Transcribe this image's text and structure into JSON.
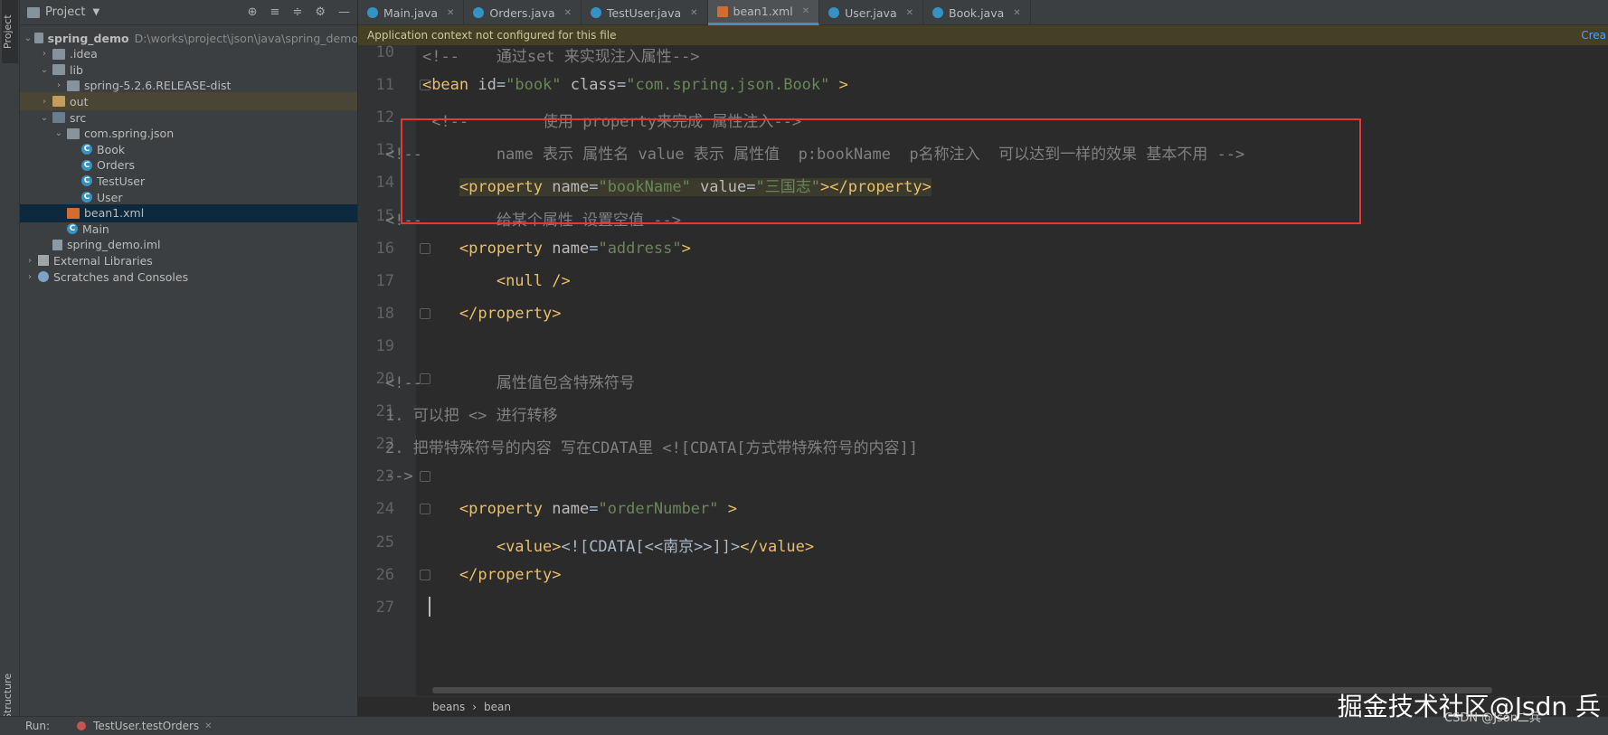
{
  "sidebar": {
    "project_tab": "Project",
    "structure_tab": "Structure"
  },
  "project_panel": {
    "title": "Project",
    "tree": [
      {
        "name": "spring_demo",
        "path": "D:\\works\\project\\json\\java\\spring_demo",
        "level": 0,
        "arrow": "expanded",
        "icon": "module-folder"
      },
      {
        "name": ".idea",
        "level": 1,
        "arrow": "collapsed",
        "icon": "folder"
      },
      {
        "name": "lib",
        "level": 1,
        "arrow": "expanded",
        "icon": "folder"
      },
      {
        "name": "spring-5.2.6.RELEASE-dist",
        "level": 2,
        "arrow": "collapsed",
        "icon": "folder"
      },
      {
        "name": "out",
        "level": 1,
        "arrow": "collapsed",
        "icon": "out-folder"
      },
      {
        "name": "src",
        "level": 1,
        "arrow": "expanded",
        "icon": "source-folder"
      },
      {
        "name": "com.spring.json",
        "level": 2,
        "arrow": "expanded",
        "icon": "package"
      },
      {
        "name": "Book",
        "level": 3,
        "icon": "class"
      },
      {
        "name": "Orders",
        "level": 3,
        "icon": "class"
      },
      {
        "name": "TestUser",
        "level": 3,
        "icon": "class"
      },
      {
        "name": "User",
        "level": 3,
        "icon": "class"
      },
      {
        "name": "bean1.xml",
        "level": 2,
        "icon": "xml",
        "selected": true
      },
      {
        "name": "Main",
        "level": 2,
        "icon": "class"
      },
      {
        "name": "spring_demo.iml",
        "level": 1,
        "icon": "file"
      },
      {
        "name": "External Libraries",
        "level": 0,
        "arrow": "collapsed",
        "icon": "library"
      },
      {
        "name": "Scratches and Consoles",
        "level": 0,
        "arrow": "collapsed",
        "icon": "scratch"
      }
    ]
  },
  "tabs": [
    {
      "label": "Main.java",
      "icon": "class"
    },
    {
      "label": "Orders.java",
      "icon": "class"
    },
    {
      "label": "TestUser.java",
      "icon": "class"
    },
    {
      "label": "bean1.xml",
      "icon": "xml",
      "active": true
    },
    {
      "label": "User.java",
      "icon": "class"
    },
    {
      "label": "Book.java",
      "icon": "class"
    }
  ],
  "notice": {
    "text": "Application context not configured for this file",
    "link": "Crea"
  },
  "editor": {
    "lines": [
      {
        "num": "10",
        "segments": [
          {
            "t": "    ",
            "c": ""
          },
          {
            "t": "<!--    通过set 来实现注入属性-->",
            "c": "comment"
          }
        ]
      },
      {
        "num": "11",
        "segments": [
          {
            "t": "    ",
            "c": ""
          },
          {
            "t": "<bean ",
            "c": "tag"
          },
          {
            "t": "id",
            "c": "attr"
          },
          {
            "t": "=",
            "c": ""
          },
          {
            "t": "\"book\"",
            "c": "str"
          },
          {
            "t": " ",
            "c": ""
          },
          {
            "t": "class",
            "c": "attr"
          },
          {
            "t": "=",
            "c": ""
          },
          {
            "t": "\"com.spring.json.Book\"",
            "c": "str"
          },
          {
            "t": " >",
            "c": "tag"
          }
        ]
      },
      {
        "num": "12",
        "segments": [
          {
            "t": "     ",
            "c": ""
          },
          {
            "t": "<!--        使用 property来完成 属性注入-->",
            "c": "comment"
          }
        ]
      },
      {
        "num": "13",
        "segments": [
          {
            "t": "<!--        name 表示 属性名 value 表示 属性值  p:bookName  p名称注入  可以达到一样的效果 基本不用 -->",
            "c": "comment"
          }
        ]
      },
      {
        "num": "14",
        "segments": [
          {
            "t": "        ",
            "c": ""
          },
          {
            "t": "<property ",
            "c": "tag hl"
          },
          {
            "t": "name",
            "c": "attr hl"
          },
          {
            "t": "=",
            "c": "hl"
          },
          {
            "t": "\"bookName\"",
            "c": "str hl"
          },
          {
            "t": " ",
            "c": "hl"
          },
          {
            "t": "value",
            "c": "attr hl"
          },
          {
            "t": "=",
            "c": "hl"
          },
          {
            "t": "\"三国志\"",
            "c": "str hl"
          },
          {
            "t": "></property>",
            "c": "tag hl"
          }
        ]
      },
      {
        "num": "15",
        "segments": [
          {
            "t": "<!--        给某个属性 设置空值 -->",
            "c": "comment"
          }
        ]
      },
      {
        "num": "16",
        "segments": [
          {
            "t": "        ",
            "c": ""
          },
          {
            "t": "<property ",
            "c": "tag"
          },
          {
            "t": "name",
            "c": "attr"
          },
          {
            "t": "=",
            "c": ""
          },
          {
            "t": "\"address\"",
            "c": "str"
          },
          {
            "t": ">",
            "c": "tag"
          }
        ]
      },
      {
        "num": "17",
        "segments": [
          {
            "t": "            ",
            "c": ""
          },
          {
            "t": "<null />",
            "c": "tag"
          }
        ]
      },
      {
        "num": "18",
        "segments": [
          {
            "t": "        ",
            "c": ""
          },
          {
            "t": "</property>",
            "c": "tag"
          }
        ]
      },
      {
        "num": "19",
        "segments": []
      },
      {
        "num": "20",
        "segments": [
          {
            "t": "<!--        属性值包含特殊符号",
            "c": "comment"
          }
        ]
      },
      {
        "num": "21",
        "segments": [
          {
            "t": "1. 可以把 <> 进行转移",
            "c": "comment"
          }
        ]
      },
      {
        "num": "22",
        "segments": [
          {
            "t": "2. 把带特殊符号的内容 写在CDATA里 <![CDATA[方式带特殊符号的内容]]",
            "c": "comment"
          }
        ]
      },
      {
        "num": "23",
        "segments": [
          {
            "t": "-->",
            "c": "comment"
          }
        ]
      },
      {
        "num": "24",
        "segments": [
          {
            "t": "        ",
            "c": ""
          },
          {
            "t": "<property ",
            "c": "tag"
          },
          {
            "t": "name",
            "c": "attr"
          },
          {
            "t": "=",
            "c": ""
          },
          {
            "t": "\"orderNumber\"",
            "c": "str"
          },
          {
            "t": " >",
            "c": "tag"
          }
        ]
      },
      {
        "num": "25",
        "segments": [
          {
            "t": "            ",
            "c": ""
          },
          {
            "t": "<value>",
            "c": "tag"
          },
          {
            "t": "<![CDATA[<<南京>>]]>",
            "c": "cdata"
          },
          {
            "t": "</value>",
            "c": "tag"
          }
        ]
      },
      {
        "num": "26",
        "segments": [
          {
            "t": "        ",
            "c": ""
          },
          {
            "t": "</property>",
            "c": "tag"
          }
        ]
      },
      {
        "num": "27",
        "segments": []
      }
    ]
  },
  "breadcrumb": [
    "beans",
    "bean"
  ],
  "runbar": {
    "label": "Run:",
    "config": "TestUser.testOrders"
  },
  "watermark": {
    "main": "掘金技术社区@Jsdn 兵",
    "sub": "CSDN @Json二兵"
  }
}
